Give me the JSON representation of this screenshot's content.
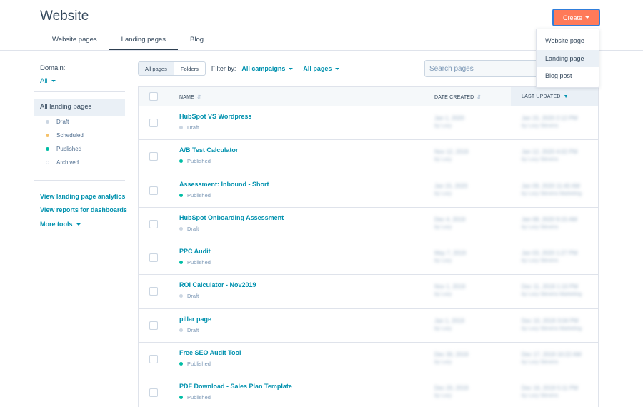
{
  "header": {
    "title": "Website",
    "create_label": "Create"
  },
  "create_menu": {
    "items": [
      "Website page",
      "Landing page",
      "Blog post"
    ],
    "hovered": "Landing page"
  },
  "tabs": [
    {
      "label": "Website pages"
    },
    {
      "label": "Landing pages",
      "active": true
    },
    {
      "label": "Blog"
    }
  ],
  "sidebar": {
    "domain_label": "Domain:",
    "domain_value": "All",
    "all_label": "All landing pages",
    "statuses": [
      {
        "label": "Draft",
        "color": "#cbd6e2"
      },
      {
        "label": "Scheduled",
        "color": "#f5c26b"
      },
      {
        "label": "Published",
        "color": "#00bda5"
      },
      {
        "label": "Archived",
        "color": "#ffffff"
      }
    ],
    "links": [
      "View landing page analytics",
      "View reports for dashboards",
      "More tools"
    ]
  },
  "filters": {
    "toggle": [
      "All pages",
      "Folders"
    ],
    "filter_by": "Filter by:",
    "campaigns": "All campaigns",
    "pages": "All pages"
  },
  "search": {
    "placeholder": "Search pages"
  },
  "table": {
    "columns": {
      "name": "NAME",
      "created": "DATE CREATED",
      "updated": "LAST UPDATED"
    },
    "rows": [
      {
        "name": "HubSpot VS Wordpress",
        "status": "Draft",
        "created": "Jan 1, 2020",
        "created_by": "by Lucy",
        "updated": "Jan 15, 2020 2:12 PM",
        "updated_by": "by Lucy Stevens"
      },
      {
        "name": "A/B Test Calculator",
        "status": "Published",
        "created": "Nov 12, 2019",
        "created_by": "by Lucy",
        "updated": "Jan 12, 2020 4:02 PM",
        "updated_by": "by Lucy Stevens"
      },
      {
        "name": "Assessment: Inbound - Short",
        "status": "Published",
        "created": "Jan 15, 2020",
        "created_by": "by Lucy",
        "updated": "Jan 09, 2020 11:40 AM",
        "updated_by": "by Lucy Stevens Marketing"
      },
      {
        "name": "HubSpot Onboarding Assessment",
        "status": "Draft",
        "created": "Dec 4, 2019",
        "created_by": "by Lucy",
        "updated": "Jan 08, 2020 9:15 AM",
        "updated_by": "by Lucy Stevens"
      },
      {
        "name": "PPC Audit",
        "status": "Published",
        "created": "May 7, 2019",
        "created_by": "by Lucy",
        "updated": "Jan 03, 2020 1:27 PM",
        "updated_by": "by Lucy Stevens"
      },
      {
        "name": "ROI Calculator - Nov2019",
        "status": "Draft",
        "created": "Nov 1, 2019",
        "created_by": "by Lucy",
        "updated": "Dec 11, 2019 1:10 PM",
        "updated_by": "by Lucy Stevens Marketing"
      },
      {
        "name": "pillar page",
        "status": "Draft",
        "created": "Jan 1, 2019",
        "created_by": "by Lucy",
        "updated": "Dec 10, 2019 3:04 PM",
        "updated_by": "by Lucy Stevens Marketing"
      },
      {
        "name": "Free SEO Audit Tool",
        "status": "Published",
        "created": "Dec 30, 2019",
        "created_by": "by Lucy",
        "updated": "Dec 17, 2019 10:22 AM",
        "updated_by": "by Lucy Stevens"
      },
      {
        "name": "PDF Download - Sales Plan Template",
        "status": "Published",
        "created": "Dec 20, 2019",
        "created_by": "by Lucy",
        "updated": "Dec 16, 2019 5:11 PM",
        "updated_by": "by Lucy Stevens"
      }
    ]
  }
}
